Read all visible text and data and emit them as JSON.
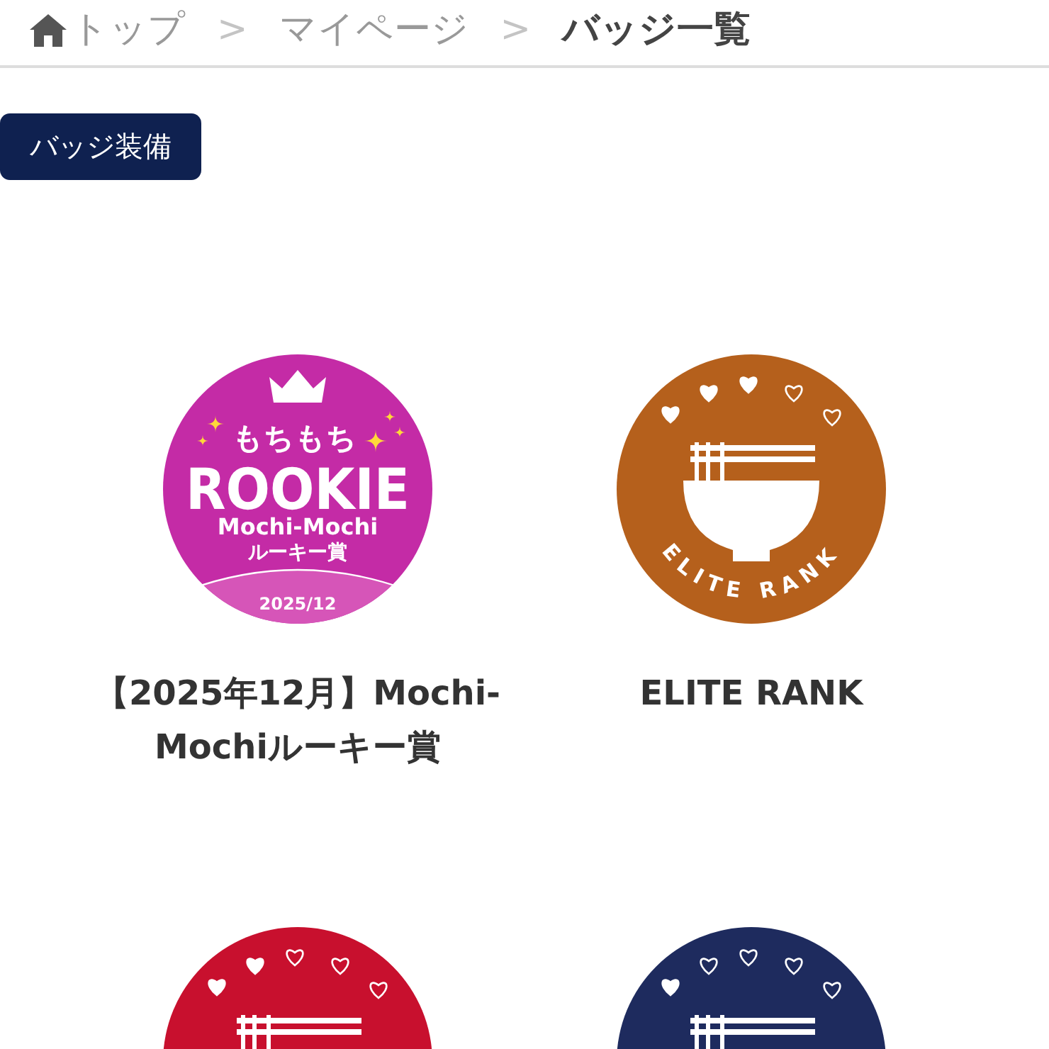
{
  "breadcrumb": {
    "separator": ">",
    "items": [
      {
        "label": "トップ",
        "current": false
      },
      {
        "label": "マイページ",
        "current": false
      },
      {
        "label": "バッジ一覧",
        "current": true
      }
    ]
  },
  "equip_button": {
    "label": "バッジ装備"
  },
  "badges": [
    {
      "kind": "rookie",
      "color": "#c42ba6",
      "texts": [
        "もちもち",
        "ROOKIE",
        "Mochi-Mochi",
        "ルーキー賞",
        "2025/12"
      ],
      "name": "【2025年12月】Mochi-Mochiルーキー賞"
    },
    {
      "kind": "rank",
      "color": "#b5601c",
      "hearts": [
        {
          "filled": true
        },
        {
          "filled": true
        },
        {
          "filled": true
        },
        {
          "filled": false
        },
        {
          "filled": false
        }
      ],
      "emblem": "ELITE RANK",
      "name": "ELITE RANK"
    },
    {
      "kind": "rank_top",
      "color": "#c8102e",
      "hearts": [
        {
          "filled": true
        },
        {
          "filled": true
        },
        {
          "filled": false
        },
        {
          "filled": false
        },
        {
          "filled": false
        }
      ]
    },
    {
      "kind": "rank_top",
      "color": "#1e2b5e",
      "hearts": [
        {
          "filled": true
        },
        {
          "filled": false
        },
        {
          "filled": false
        },
        {
          "filled": false
        },
        {
          "filled": false
        }
      ]
    }
  ]
}
